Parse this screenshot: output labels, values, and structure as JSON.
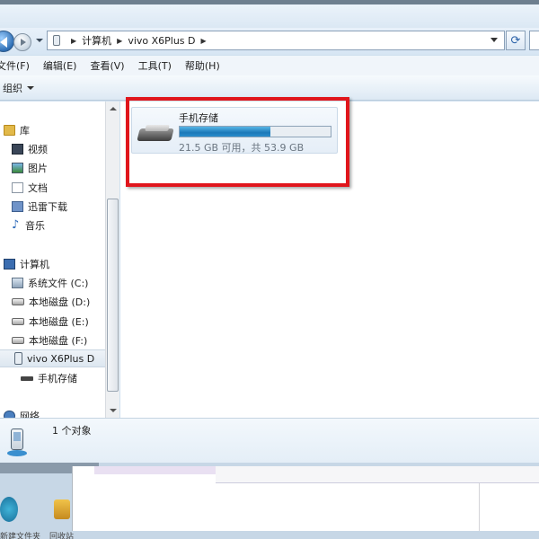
{
  "address_bar": {
    "crumbs": [
      "计算机",
      "vivo X6Plus D"
    ]
  },
  "menu": {
    "items": [
      "文件(F)",
      "编辑(E)",
      "查看(V)",
      "工具(T)",
      "帮助(H)"
    ]
  },
  "toolbar": {
    "organize_label": "组织"
  },
  "nav": {
    "libraries": "库",
    "videos": "视频",
    "pictures": "图片",
    "documents": "文档",
    "thunder_downloads": "迅雷下载",
    "music": "音乐",
    "computer": "计算机",
    "drive_c": "系统文件 (C:)",
    "drive_d": "本地磁盘 (D:)",
    "drive_e": "本地磁盘 (E:)",
    "drive_f": "本地磁盘 (F:)",
    "device": "vivo X6Plus D",
    "phone_storage": "手机存储",
    "network": "网络"
  },
  "content": {
    "storage_name": "手机存储",
    "storage_free_text": "21.5 GB 可用，共 53.9 GB",
    "used_fraction": 0.6
  },
  "details": {
    "count_text": "1 个对象"
  },
  "background": {
    "left_label": "新建文件夹",
    "mid_label": "回收站"
  },
  "colors": {
    "highlight_box": "#e0161c",
    "progress_fill": "#1c79b8"
  }
}
